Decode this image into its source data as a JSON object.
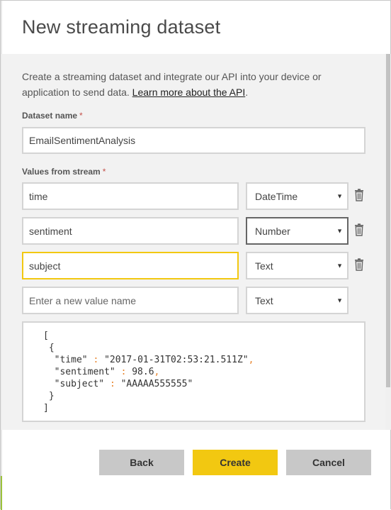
{
  "dialog": {
    "title": "New streaming dataset",
    "intro_text": "Create a streaming dataset and integrate our API into your device or application to send data. ",
    "learn_more_link": "Learn more about the API",
    "intro_suffix": "."
  },
  "dataset_name": {
    "label": "Dataset name",
    "required_marker": "*",
    "value": "EmailSentimentAnalysis"
  },
  "values_from_stream": {
    "label": "Values from stream",
    "required_marker": "*",
    "rows": [
      {
        "name": "time",
        "type": "DateTime"
      },
      {
        "name": "sentiment",
        "type": "Number"
      },
      {
        "name": "subject",
        "type": "Text"
      }
    ],
    "new_value_placeholder": "Enter a new value name",
    "new_value_type": "Text"
  },
  "json_preview": {
    "open_bracket": "[",
    "open_brace": "{",
    "lines": [
      {
        "key": "\"time\"",
        "sep": ":",
        "value": "\"2017-01-31T02:53:21.511Z\"",
        "trail": ","
      },
      {
        "key": "\"sentiment\"",
        "sep": ":",
        "value": "98.6",
        "trail": ","
      },
      {
        "key": "\"subject\"",
        "sep": ":",
        "value": "\"AAAAA555555\"",
        "trail": ""
      }
    ],
    "close_brace": "}",
    "close_bracket": "]"
  },
  "footer": {
    "back_label": "Back",
    "create_label": "Create",
    "cancel_label": "Cancel"
  },
  "icons": {
    "dropdown": "chevron-down-icon",
    "delete": "trash-icon"
  },
  "colors": {
    "accent": "#f2c811",
    "required": "#c4514a",
    "json_punct": "#e8832a",
    "secondary_button": "#c8c8c8"
  }
}
